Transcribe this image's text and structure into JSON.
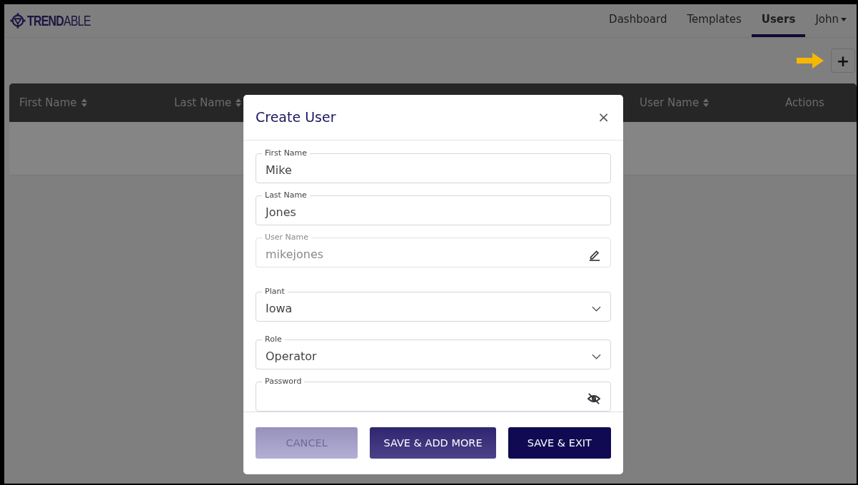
{
  "logo": {
    "text": "**TREND**ABLE"
  },
  "nav": [
    {
      "label": "Dashboard",
      "kind": "link",
      "selected": false
    },
    {
      "label": "Templates",
      "kind": "link",
      "selected": false
    },
    {
      "label": "Users",
      "kind": "link",
      "selected": true
    },
    {
      "label": "John",
      "kind": "menu",
      "selected": false
    }
  ],
  "add_button": {
    "label": "+"
  },
  "table": {
    "columns": [
      {
        "label": "First Name",
        "sortable": true
      },
      {
        "label": "Last Name",
        "sortable": true
      },
      {
        "label": "User Name",
        "sortable": true
      },
      {
        "label": "Actions",
        "sortable": false
      }
    ]
  },
  "dialog": {
    "title": "Create User",
    "close": "×",
    "fields": [
      {
        "label": "First Name",
        "value": "Mike",
        "kind": "text",
        "disabled": false
      },
      {
        "label": "Last Name",
        "value": "Jones",
        "kind": "text",
        "disabled": false
      },
      {
        "label": "User Name",
        "value": "mikejones",
        "kind": "locked",
        "disabled": true
      },
      {
        "label": "Plant",
        "value": "Iowa",
        "kind": "select",
        "disabled": false
      },
      {
        "label": "Role",
        "value": "Operator",
        "kind": "select",
        "disabled": false
      },
      {
        "label": "Password",
        "kind": "password",
        "disabled": false
      }
    ],
    "buttons": [
      {
        "label": "CANCEL",
        "kind": "cancel"
      },
      {
        "label": "SAVE & ADD MORE",
        "kind": "secondary"
      },
      {
        "label": "SAVE & EXIT",
        "kind": "primary"
      }
    ]
  }
}
